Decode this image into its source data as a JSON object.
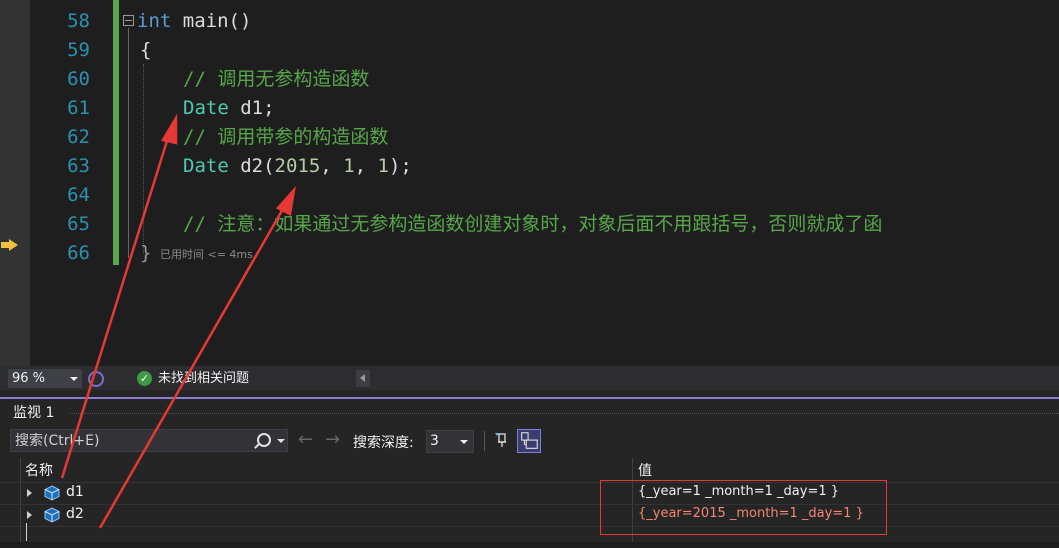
{
  "editor": {
    "line_numbers": [
      "58",
      "59",
      "60",
      "61",
      "62",
      "63",
      "64",
      "65",
      "66"
    ],
    "code": {
      "l58_kw": "int",
      "l58_rest": " main()",
      "l59": "{",
      "l60": "// 调用无参构造函数",
      "l61_type": "Date",
      "l61_rest": " d1;",
      "l62": "// 调用带参的构造函数",
      "l63_type": "Date",
      "l63_name": " d2(",
      "l63_a": "2015",
      "l63_s1": ", ",
      "l63_b": "1",
      "l63_s2": ", ",
      "l63_c": "1",
      "l63_end": ");",
      "l65": "// 注意：如果通过无参构造函数创建对象时，对象后面不用跟括号，否则就成了函",
      "l66": "}"
    },
    "perf_tip": "已用时间 <= 4ms",
    "colors": {
      "keyword": "#569cd6",
      "type": "#4ec9b0",
      "comment": "#57a64a",
      "number": "#b5cea8",
      "line_number": "#2b91af",
      "change_bar": "#57a64a"
    }
  },
  "status_bar": {
    "zoom": "96 %",
    "issues": "未找到相关问题",
    "ok_glyph": "✓",
    "icons": [
      "intellicode-icon",
      "check-circle-icon",
      "scroll-left-icon"
    ]
  },
  "watch": {
    "title": "监视 1",
    "search_placeholder": "搜索(Ctrl+E)",
    "back_glyph": "←",
    "forward_glyph": "→",
    "depth_label": "搜索深度:",
    "depth_value": "3",
    "columns": {
      "name": "名称",
      "value": "值"
    },
    "rows": [
      {
        "name": "d1",
        "value": "{_year=1 _month=1 _day=1 }",
        "value_color": "#f1f1f1"
      },
      {
        "name": "d2",
        "value": "{_year=2015 _month=1 _day=1 }",
        "value_color": "#f48771"
      }
    ],
    "icons": [
      "search-icon",
      "pin-icon",
      "hex-display-icon",
      "class-object-icon"
    ]
  },
  "annotation_color": "#e53935"
}
